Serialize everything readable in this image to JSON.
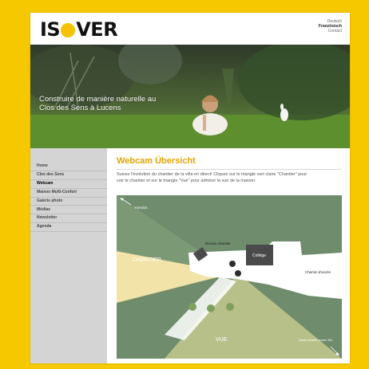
{
  "header": {
    "logo_prefix": "IS",
    "logo_suffix": "VER",
    "languages": [
      "Deutsch",
      "Französisch",
      "Contact"
    ]
  },
  "banner": {
    "text": "Construire de manière naturelle au Clos des Sens à Lucens"
  },
  "sidebar": {
    "items": [
      {
        "label": "Home"
      },
      {
        "label": "Clos des Sens"
      },
      {
        "label": "Webcam"
      },
      {
        "label": "Maison Multi-Confort"
      },
      {
        "label": "Galerie photo"
      },
      {
        "label": "Médias"
      },
      {
        "label": "Newsletter"
      },
      {
        "label": "Agenda"
      }
    ]
  },
  "main": {
    "title": "Webcam Übersicht",
    "intro": "Suivez l'évolution du chantier de la villa en direct! Cliquez sur le triangle vert claire \"Chantier\" pour voir le chantier et sur le triangle \"Vue\" pour admirer la vue de la maison."
  },
  "map": {
    "labels": {
      "yverdon": "Yverdon",
      "bureau": "Bureau chantier",
      "college": "Collège",
      "chantier": "CHANTIER",
      "chemin": "Chemin d'accès",
      "vue": "VUE",
      "saint": "Saint-Gobain Isover SA"
    },
    "colors": {
      "green": "#6f8c6d",
      "beige": "#f2e3a8",
      "dark": "#4a4a4a"
    }
  }
}
